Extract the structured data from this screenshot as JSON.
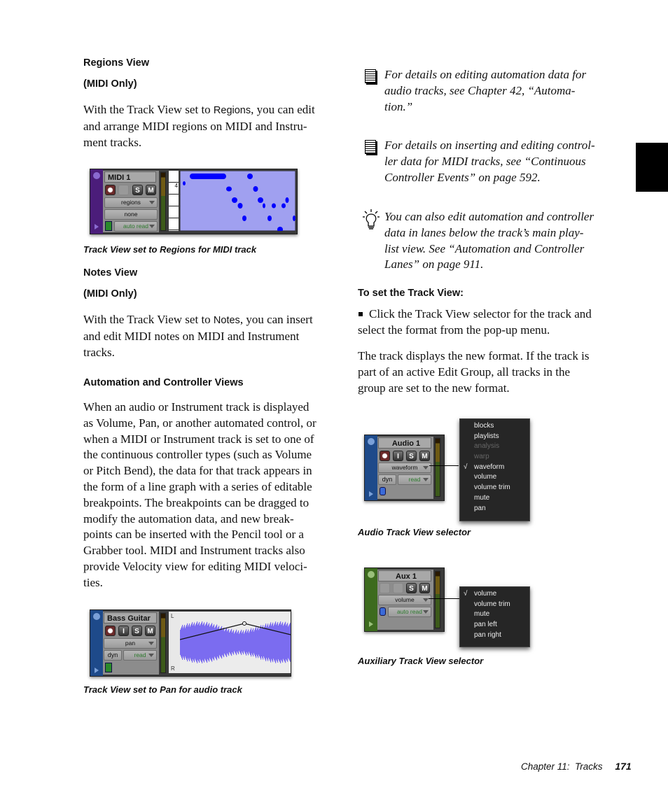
{
  "left": {
    "regions": {
      "heading": "Regions View",
      "subheading": "(MIDI Only)",
      "body_pre": "With the Track View set to ",
      "body_term": "Regions",
      "body_lines": [
        ", you can edit",
        "and arrange MIDI regions on MIDI and Instru-",
        "ment tracks."
      ],
      "caption": "Track View set to Regions for MIDI track",
      "figure": {
        "track_name": "MIDI 1",
        "buttons": [
          "S",
          "M"
        ],
        "view_selector": "regions",
        "second_selector": "none",
        "automation_mode": "auto read",
        "ruler_label": "4",
        "note_color": "#0000ff",
        "lane_color": "#a0a0f0",
        "strip_color": "#4b1d7a"
      }
    },
    "notes": {
      "heading": "Notes View",
      "subheading": "(MIDI Only)",
      "body_pre": "With the Track View set to ",
      "body_term": "Notes",
      "body_lines": [
        ", you can insert",
        "and edit MIDI notes on MIDI and Instrument",
        "tracks."
      ]
    },
    "automation": {
      "heading": "Automation and Controller Views",
      "lines": [
        "When an audio or Instrument track is displayed",
        "as Volume, Pan, or another automated control, or",
        "when a MIDI or Instrument track is set to one of",
        "the continuous controller types (such as Volume",
        "or Pitch Bend), the data for that track appears in",
        "the form of a line graph with a series of editable",
        "breakpoints. The breakpoints can be dragged to",
        "modify the automation data, and new break-",
        "points can be inserted with the Pencil tool or a",
        "Grabber tool. MIDI and Instrument tracks also",
        "provide Velocity view for editing MIDI veloci-",
        "ties."
      ],
      "caption": "Track View set to Pan for audio track",
      "figure": {
        "track_name": "Bass Guitar",
        "buttons": [
          "I",
          "S",
          "M"
        ],
        "view_selector": "pan",
        "dyn_label": "dyn",
        "automation_mode": "read",
        "lane_top_label": "L",
        "lane_bottom_label": "R",
        "waveform_color": "#7b6cf0",
        "strip_color": "#1e4a8a"
      }
    }
  },
  "right": {
    "notes": [
      {
        "icon": "document-icon",
        "lines": [
          "For details on editing automation data for",
          "audio tracks, see Chapter 42, “Automa-",
          "tion.”"
        ]
      },
      {
        "icon": "document-icon",
        "lines": [
          "For details on inserting and editing control-",
          "ler data for MIDI tracks, see “Continuous",
          "Controller Events” on page 592."
        ]
      },
      {
        "icon": "lightbulb-icon",
        "lines": [
          "You can also edit automation and controller",
          "data in lanes below the track’s main play-",
          "list view. See “Automation and Controller",
          "Lanes” on page 911."
        ]
      }
    ],
    "procedure": {
      "heading": "To set the Track View:",
      "step_lines": [
        "Click the Track View selector for the track and",
        "select the format from the pop-up menu."
      ],
      "result_lines": [
        "The track displays the new format. If the track is",
        "part of an active Edit Group, all tracks in the",
        "group are set to the new format."
      ]
    },
    "audio_figure": {
      "track_name": "Audio 1",
      "buttons": [
        "I",
        "S",
        "M"
      ],
      "view_selector": "waveform",
      "dyn_label": "dyn",
      "automation_mode": "read",
      "menu_items": [
        {
          "label": "blocks",
          "disabled": false,
          "checked": false
        },
        {
          "label": "playlists",
          "disabled": false,
          "checked": false
        },
        {
          "label": "analysis",
          "disabled": true,
          "checked": false
        },
        {
          "label": "warp",
          "disabled": true,
          "checked": false
        },
        {
          "label": "waveform",
          "disabled": false,
          "checked": true
        },
        {
          "label": "volume",
          "disabled": false,
          "checked": false
        },
        {
          "label": "volume trim",
          "disabled": false,
          "checked": false
        },
        {
          "label": "mute",
          "disabled": false,
          "checked": false
        },
        {
          "label": "pan",
          "disabled": false,
          "checked": false
        }
      ],
      "caption": "Audio Track View selector",
      "strip_color": "#1e4a8a"
    },
    "aux_figure": {
      "track_name": "Aux 1",
      "buttons": [
        "S",
        "M"
      ],
      "view_selector": "volume",
      "automation_mode": "auto read",
      "menu_items": [
        {
          "label": "volume",
          "disabled": false,
          "checked": true
        },
        {
          "label": "volume trim",
          "disabled": false,
          "checked": false
        },
        {
          "label": "mute",
          "disabled": false,
          "checked": false
        },
        {
          "label": "pan left",
          "disabled": false,
          "checked": false
        },
        {
          "label": "pan right",
          "disabled": false,
          "checked": false
        }
      ],
      "caption": "Auxiliary Track View selector",
      "strip_color": "#3d6b1e"
    },
    "checkmark": "√"
  },
  "footer": {
    "chapter": "Chapter 11:  Tracks",
    "page_number": "171"
  }
}
